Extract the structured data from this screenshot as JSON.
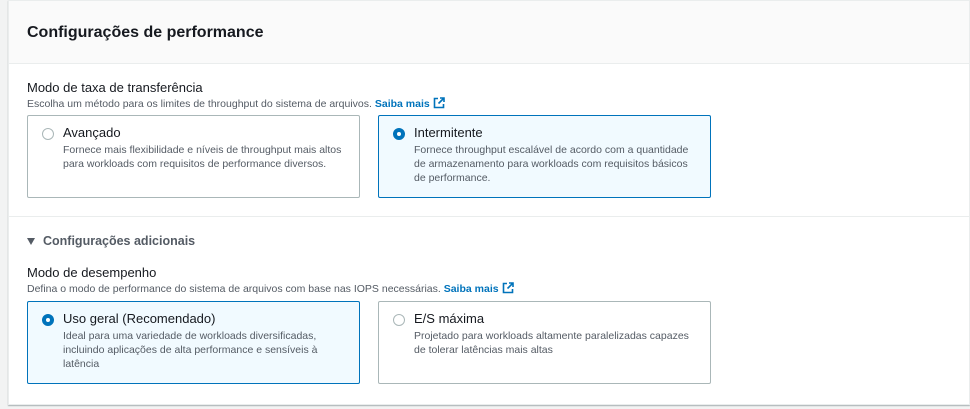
{
  "panel": {
    "title": "Configurações de performance"
  },
  "throughput": {
    "label": "Modo de taxa de transferência",
    "description": "Escolha um método para os limites de throughput do sistema de arquivos.",
    "learn_more": "Saiba mais",
    "options": [
      {
        "title": "Avançado",
        "description": "Fornece mais flexibilidade e níveis de throughput mais altos para workloads com requisitos de performance diversos.",
        "selected": false
      },
      {
        "title": "Intermitente",
        "description": "Fornece throughput escalável de acordo com a quantidade de armazenamento para workloads com requisitos básicos de performance.",
        "selected": true
      }
    ]
  },
  "additional": {
    "expander_label": "Configurações adicionais"
  },
  "performance_mode": {
    "label": "Modo de desempenho",
    "description": "Defina o modo de performance do sistema de arquivos com base nas IOPS necessárias.",
    "learn_more": "Saiba mais",
    "options": [
      {
        "title": "Uso geral (Recomendado)",
        "description": "Ideal para uma variedade de workloads diversificadas, incluindo aplicações de alta performance e sensíveis à latência",
        "selected": true
      },
      {
        "title": "E/S máxima",
        "description": "Projetado para workloads altamente paralelizadas capazes de tolerar latências mais altas",
        "selected": false
      }
    ]
  },
  "colors": {
    "accent": "#0073bb",
    "selected_bg": "#f1faff",
    "border": "#aab7b8",
    "text": "#16191f",
    "muted": "#545b64"
  }
}
